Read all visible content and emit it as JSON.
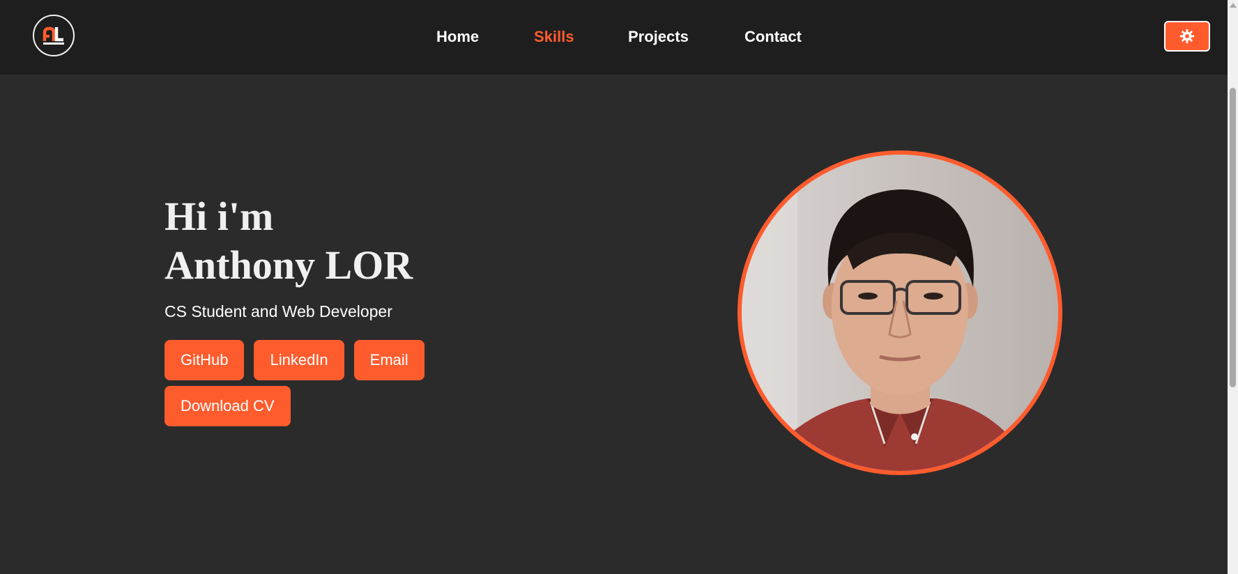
{
  "brand": {
    "logo_text": "AL"
  },
  "nav": {
    "items": [
      {
        "label": "Home",
        "active": false
      },
      {
        "label": "Skills",
        "active": true
      },
      {
        "label": "Projects",
        "active": false
      },
      {
        "label": "Contact",
        "active": false
      }
    ]
  },
  "theme_toggle": {
    "icon": "gear-icon"
  },
  "hero": {
    "title_line1": "Hi i'm",
    "title_line2": "Anthony LOR",
    "subtitle": "CS Student and Web Developer",
    "buttons": {
      "github": "GitHub",
      "linkedin": "LinkedIn",
      "email": "Email",
      "download_cv": "Download CV"
    }
  },
  "colors": {
    "accent": "#ff5c2e",
    "background": "#2b2b2b",
    "navbar": "#1e1e1e",
    "text": "#ffffff"
  }
}
